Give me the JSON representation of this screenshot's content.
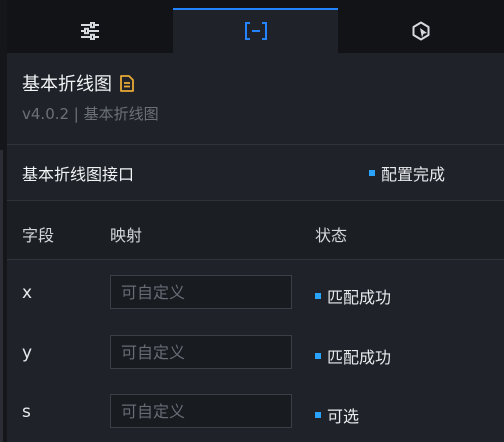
{
  "tabs": [
    {
      "icon": "sliders-icon",
      "active": false
    },
    {
      "icon": "bracket-minus-icon",
      "active": true
    },
    {
      "icon": "shape-pointer-icon",
      "active": false
    }
  ],
  "header": {
    "title": "基本折线图",
    "title_icon": "document-icon",
    "subtitle": "v4.0.2 | 基本折线图"
  },
  "interface": {
    "title": "基本折线图接口",
    "status": "配置完成",
    "status_color": "#2aa3ff"
  },
  "table": {
    "columns": [
      "字段",
      "映射",
      "状态"
    ],
    "rows": [
      {
        "field": "x",
        "placeholder": "可自定义",
        "status": "匹配成功"
      },
      {
        "field": "y",
        "placeholder": "可自定义",
        "status": "匹配成功"
      },
      {
        "field": "s",
        "placeholder": "可自定义",
        "status": "可选"
      }
    ]
  },
  "colors": {
    "accent": "#2483ff",
    "icon_yellow": "#e8a936"
  }
}
